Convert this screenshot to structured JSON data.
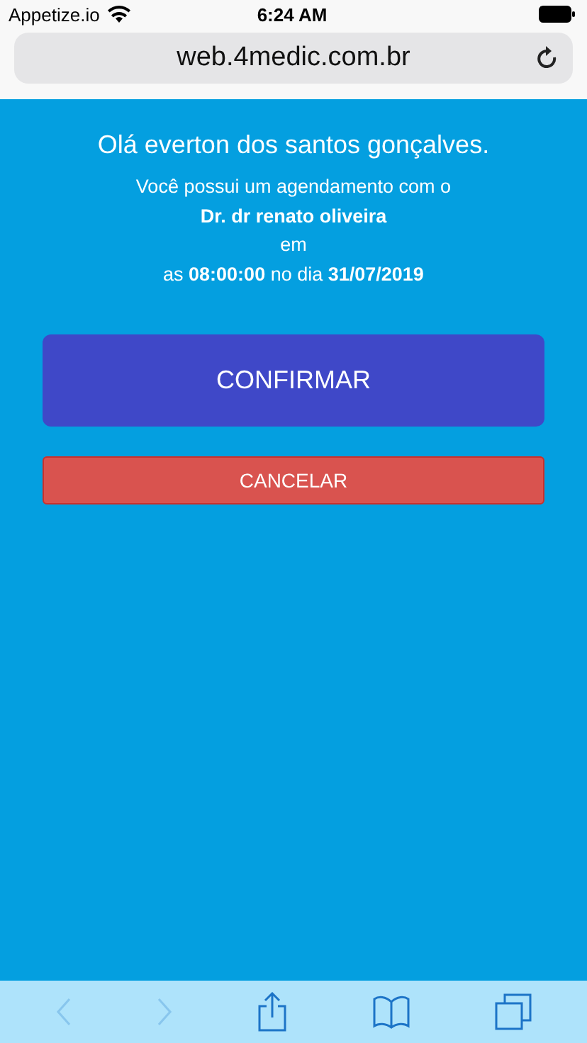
{
  "status_bar": {
    "carrier": "Appetize.io",
    "time": "6:24 AM"
  },
  "browser": {
    "url": "web.4medic.com.br"
  },
  "message": {
    "greeting": "Olá everton dos santos gonçalves.",
    "lines": [
      {
        "text": "Você possui um agendamento com o",
        "bold": false
      },
      {
        "text": "Dr. dr renato oliveira",
        "bold": true
      },
      {
        "text": "em",
        "bold": false
      },
      {
        "text": "as **08:00:00** no dia **31/07/2019**",
        "bold": false
      }
    ]
  },
  "buttons": [
    {
      "label": "CONFIRMAR",
      "kind": "primary"
    },
    {
      "label": "CANCELAR",
      "kind": "danger"
    }
  ],
  "toolbar": [
    {
      "kind": "back",
      "disabled": true
    },
    {
      "kind": "forward",
      "disabled": true
    },
    {
      "kind": "share",
      "disabled": false
    },
    {
      "kind": "bookmarks",
      "disabled": false
    },
    {
      "kind": "tabs",
      "disabled": false
    }
  ]
}
